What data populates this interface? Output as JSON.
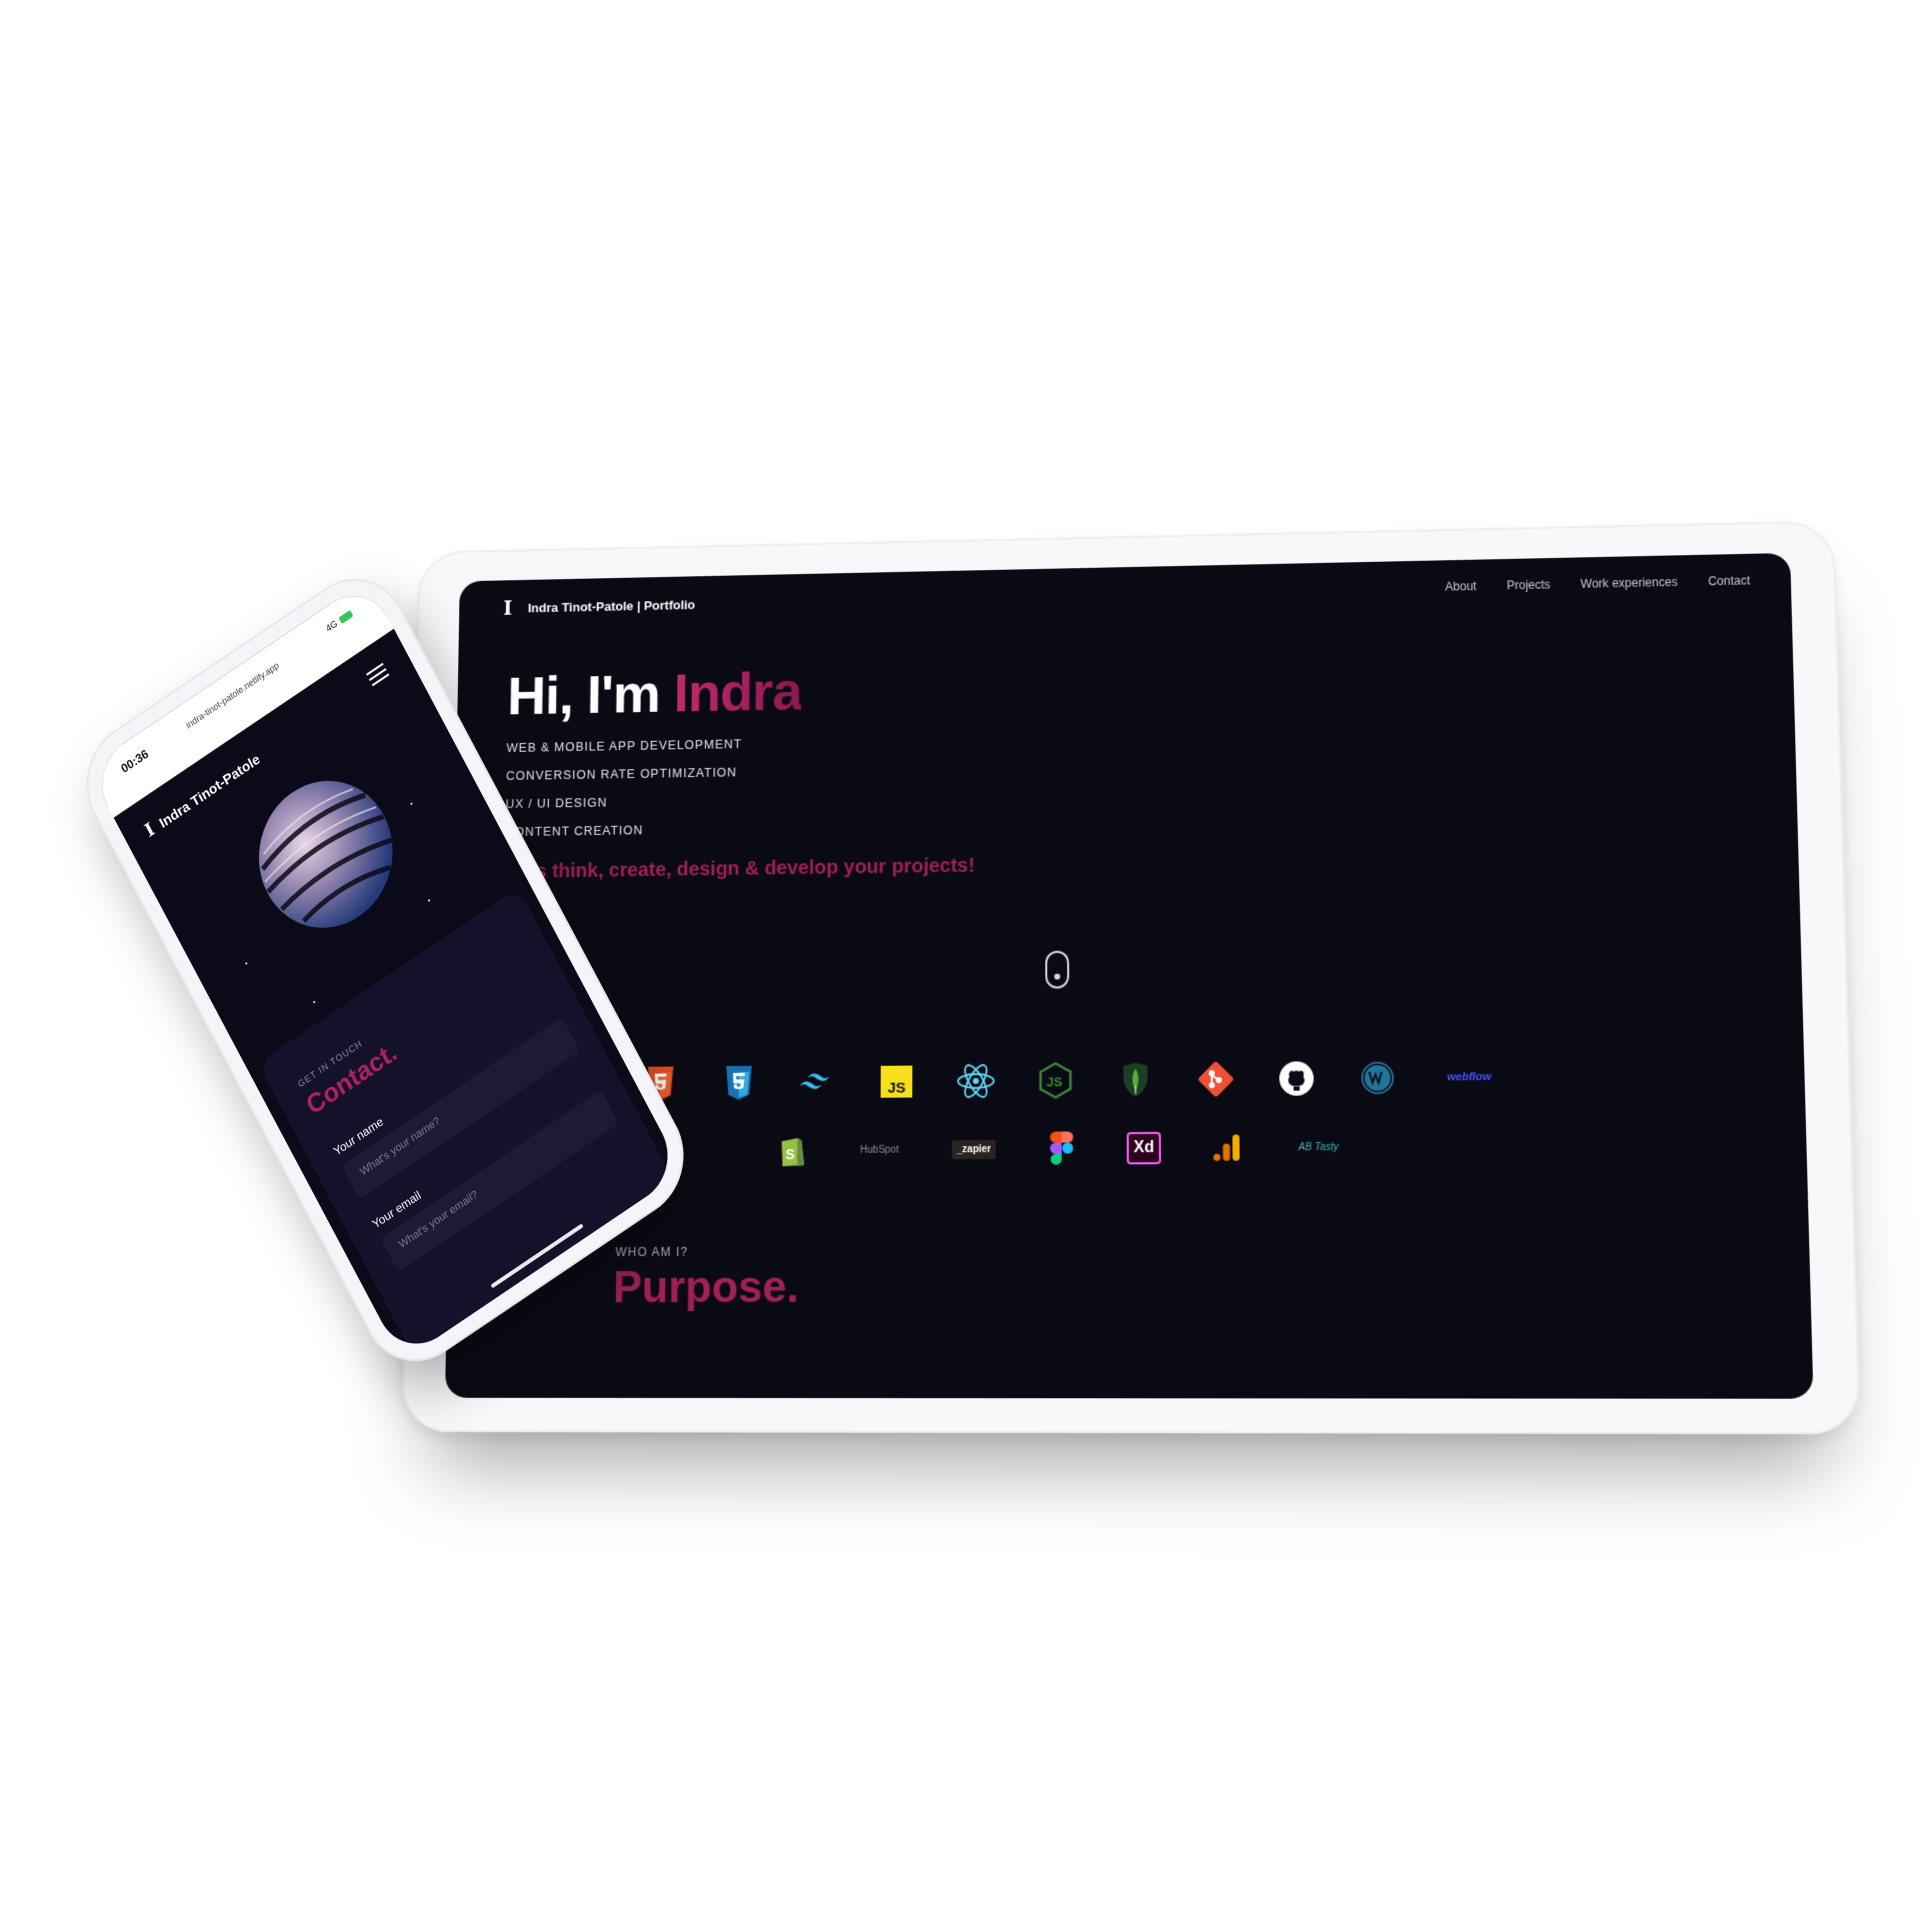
{
  "tablet": {
    "brand": "Indra Tinot-Patole | Portfolio",
    "logo_glyph": "I",
    "nav": [
      {
        "label": "About"
      },
      {
        "label": "Projects"
      },
      {
        "label": "Work experiences"
      },
      {
        "label": "Contact"
      }
    ],
    "hero": {
      "greeting": "Hi, I'm",
      "name": "Indra",
      "services": [
        "WEB & MOBILE APP DEVELOPMENT",
        "CONVERSION RATE OPTIMIZATION",
        "UX / UI DESIGN",
        "CONTENT CREATION"
      ],
      "tagline": "Let's think, create, design & develop your projects!"
    },
    "tech_row_1": [
      "html5-icon",
      "css3-icon",
      "tailwind-icon",
      "javascript-icon",
      "react-icon",
      "nodejs-icon",
      "mongodb-icon",
      "git-icon",
      "github-icon",
      "wordpress-icon"
    ],
    "tech_text_webflow": "webflow",
    "tech_row_2_hubspot": "HubSpot",
    "tech_row_2_zapier": "_zapier",
    "tech_row_2_xd": "Xd",
    "tech_row_2_abtasty": "AB Tasty",
    "who": {
      "eyebrow": "WHO AM I?",
      "title": "Purpose."
    },
    "colors": {
      "accent": "#b0215e",
      "background": "#0a0a14"
    }
  },
  "phone": {
    "status_time": "00:36",
    "status_url": "indra-tinot-patole.netlify.app",
    "status_signal": "4G",
    "brand": "Indra Tinot-Patole",
    "logo_glyph": "I",
    "contact": {
      "eyebrow": "GET IN TOUCH",
      "title": "Contact.",
      "name_label": "Your name",
      "name_placeholder": "What's your name?",
      "email_label": "Your email",
      "email_placeholder": "What's your email?"
    }
  }
}
